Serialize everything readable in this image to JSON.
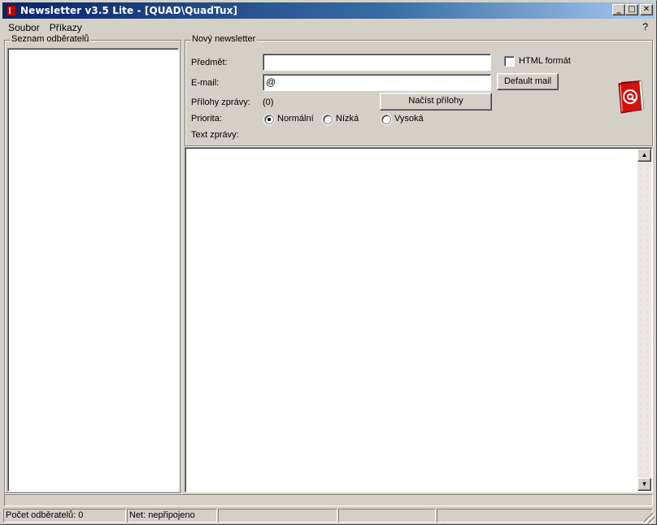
{
  "window": {
    "title": "Newsletter v3.5 Lite - [QUAD\\QuadTux]",
    "buttons": {
      "minimize": "_",
      "maximize": "□",
      "close": "✕"
    }
  },
  "menu": {
    "items": [
      {
        "label": "Soubor"
      },
      {
        "label": "Příkazy"
      }
    ],
    "help": "?"
  },
  "subscribers": {
    "title": "Seznam odběratelů",
    "items": []
  },
  "newsletter": {
    "title": "Nový newsletter",
    "subject_label": "Předmět:",
    "subject_value": "",
    "email_label": "E-mail:",
    "email_value": "@",
    "attachments_label": "Přílohy zprávy:",
    "attachments_count": "(0)",
    "load_attachments_button": "Načíst přílohy",
    "html_format_label": "HTML formát",
    "html_format_checked": false,
    "default_mail_button": "Default mail",
    "priority_label": "Priorita:",
    "priority_options": [
      {
        "label": "Normální",
        "selected": true
      },
      {
        "label": "Nízká",
        "selected": false
      },
      {
        "label": "Vysoká",
        "selected": false
      }
    ],
    "text_label": "Text zprávy:",
    "icon": "address-book-icon",
    "accent_color": "#c00000"
  },
  "message": {
    "text": ""
  },
  "statusbar": {
    "subscriber_count": "Počet odběratelů: 0",
    "network": "Net: nepřipojeno",
    "panel3": "",
    "panel4": "",
    "panel5": ""
  }
}
